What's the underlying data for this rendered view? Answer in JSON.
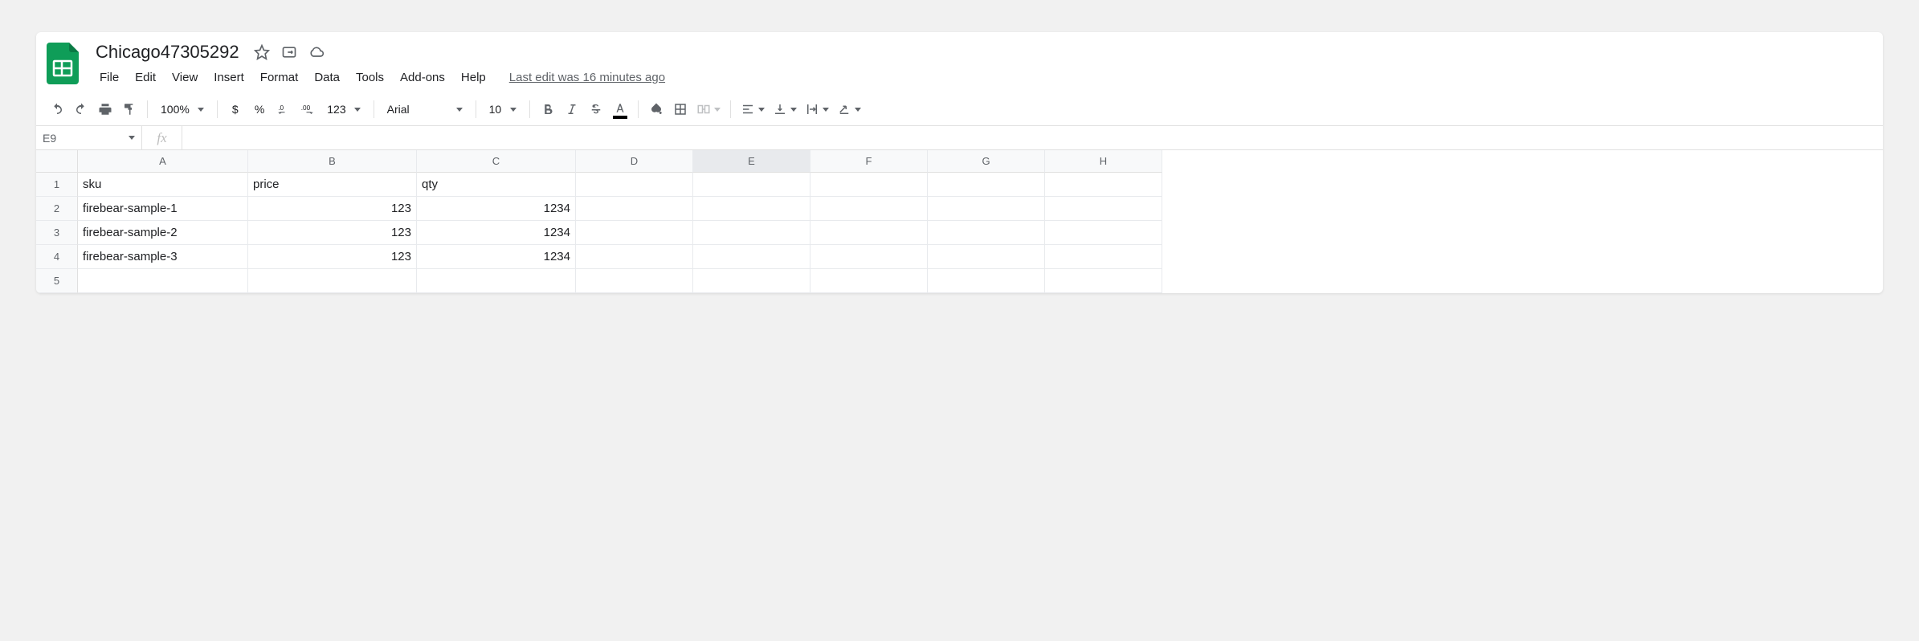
{
  "doc": {
    "title": "Chicago47305292",
    "last_edit": "Last edit was 16 minutes ago"
  },
  "menu": {
    "file": "File",
    "edit": "Edit",
    "view": "View",
    "insert": "Insert",
    "format": "Format",
    "data": "Data",
    "tools": "Tools",
    "addons": "Add-ons",
    "help": "Help"
  },
  "toolbar": {
    "zoom": "100%",
    "currency": "$",
    "percent": "%",
    "dec_dec": ".0",
    "inc_dec": ".00",
    "more_formats": "123",
    "font": "Arial",
    "font_size": "10"
  },
  "namebox": "E9",
  "fx_label": "fx",
  "columns": [
    "A",
    "B",
    "C",
    "D",
    "E",
    "F",
    "G",
    "H"
  ],
  "selected_col": "E",
  "row_numbers": [
    "1",
    "2",
    "3",
    "4",
    "5"
  ],
  "cells": {
    "r1": {
      "A": "sku",
      "B": "price",
      "C": "qty"
    },
    "r2": {
      "A": "firebear-sample-1",
      "B": "123",
      "C": "1234"
    },
    "r3": {
      "A": "firebear-sample-2",
      "B": "123",
      "C": "1234"
    },
    "r4": {
      "A": "firebear-sample-3",
      "B": "123",
      "C": "1234"
    }
  }
}
